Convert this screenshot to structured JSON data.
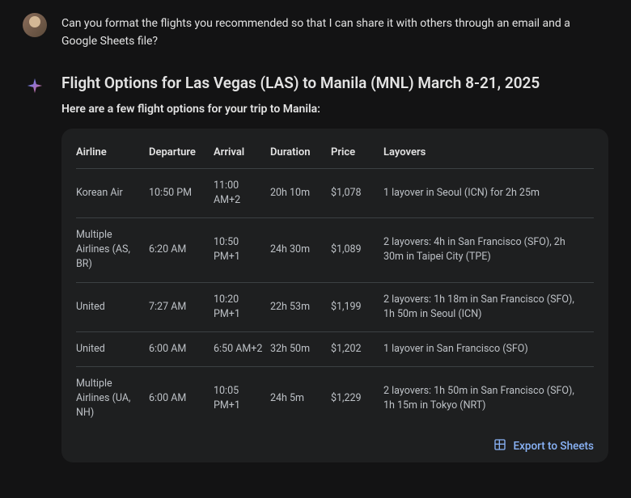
{
  "user": {
    "message": "Can you format the flights you recommended so that I can share it with others through an email and a Google Sheets file?"
  },
  "assistant": {
    "title": "Flight Options for Las Vegas (LAS) to Manila (MNL) March 8-21, 2025",
    "subtitle": "Here are a few flight options for your trip to Manila:"
  },
  "table": {
    "headers": {
      "airline": "Airline",
      "departure": "Departure",
      "arrival": "Arrival",
      "duration": "Duration",
      "price": "Price",
      "layovers": "Layovers"
    },
    "rows": [
      {
        "airline": "Korean Air",
        "departure": "10:50 PM",
        "arrival": "11:00 AM+2",
        "duration": "20h 10m",
        "price": "$1,078",
        "layovers": "1 layover in Seoul (ICN) for 2h 25m"
      },
      {
        "airline": "Multiple Airlines (AS, BR)",
        "departure": "6:20 AM",
        "arrival": "10:50 PM+1",
        "duration": "24h 30m",
        "price": "$1,089",
        "layovers": "2 layovers: 4h in San Francisco (SFO), 2h 30m in Taipei City (TPE)"
      },
      {
        "airline": "United",
        "departure": "7:27 AM",
        "arrival": "10:20 PM+1",
        "duration": "22h 53m",
        "price": "$1,199",
        "layovers": "2 layovers: 1h 18m in San Francisco (SFO), 1h 50m in Seoul (ICN)"
      },
      {
        "airline": "United",
        "departure": "6:00 AM",
        "arrival": "6:50 AM+2",
        "duration": "32h 50m",
        "price": "$1,202",
        "layovers": "1 layover in San Francisco (SFO)"
      },
      {
        "airline": "Multiple Airlines (UA, NH)",
        "departure": "6:00 AM",
        "arrival": "10:05 PM+1",
        "duration": "24h 5m",
        "price": "$1,229",
        "layovers": "2 layovers: 1h 50m in San Francisco (SFO), 1h 15m in Tokyo (NRT)"
      }
    ]
  },
  "export": {
    "label": "Export to Sheets"
  }
}
